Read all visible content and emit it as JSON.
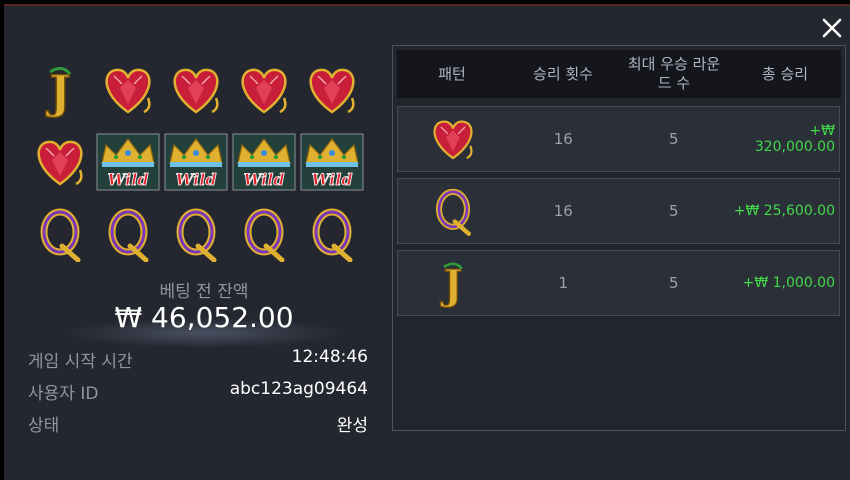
{
  "reels": [
    [
      "jack-j-symbol",
      "ruby-heart-symbol",
      "ruby-heart-symbol",
      "ruby-heart-symbol",
      "ruby-heart-symbol"
    ],
    [
      "ruby-heart-symbol",
      "wild-crown-symbol",
      "wild-crown-symbol",
      "wild-crown-symbol",
      "wild-crown-symbol"
    ],
    [
      "queen-q-symbol",
      "queen-q-symbol",
      "queen-q-symbol",
      "queen-q-symbol",
      "queen-q-symbol"
    ]
  ],
  "symbol_text": {
    "jack": "J",
    "queen": "Q",
    "wild": "Wild"
  },
  "balance": {
    "label": "베팅 전 잔액",
    "amount": "₩ 46,052.00"
  },
  "info": {
    "start_time_label": "게임 시작 시간",
    "start_time_value": "12:48:46",
    "user_id_label": "사용자 ID",
    "user_id_value": "abc123ag09464",
    "status_label": "상태",
    "status_value": "완성"
  },
  "table": {
    "headers": {
      "pattern": "패턴",
      "wins": "승리 횟수",
      "max_round_1": "최대 우승 라운",
      "max_round_2": "드 수",
      "total": "총 승리"
    },
    "rows": [
      {
        "symbol": "ruby-heart-symbol",
        "wins": "16",
        "max_rounds": "5",
        "total": "+₩ 320,000.00"
      },
      {
        "symbol": "queen-q-symbol",
        "wins": "16",
        "max_rounds": "5",
        "total": "+₩ 25,600.00"
      },
      {
        "symbol": "jack-j-symbol",
        "wins": "1",
        "max_rounds": "5",
        "total": "+₩ 1,000.00"
      }
    ]
  },
  "colors": {
    "background": "#24272f",
    "win_green": "#42d84a",
    "ruby_red": "#c81e3a",
    "gold": "#e0b030",
    "purple": "#7a38b8"
  },
  "icons": {
    "close": "close-icon"
  }
}
